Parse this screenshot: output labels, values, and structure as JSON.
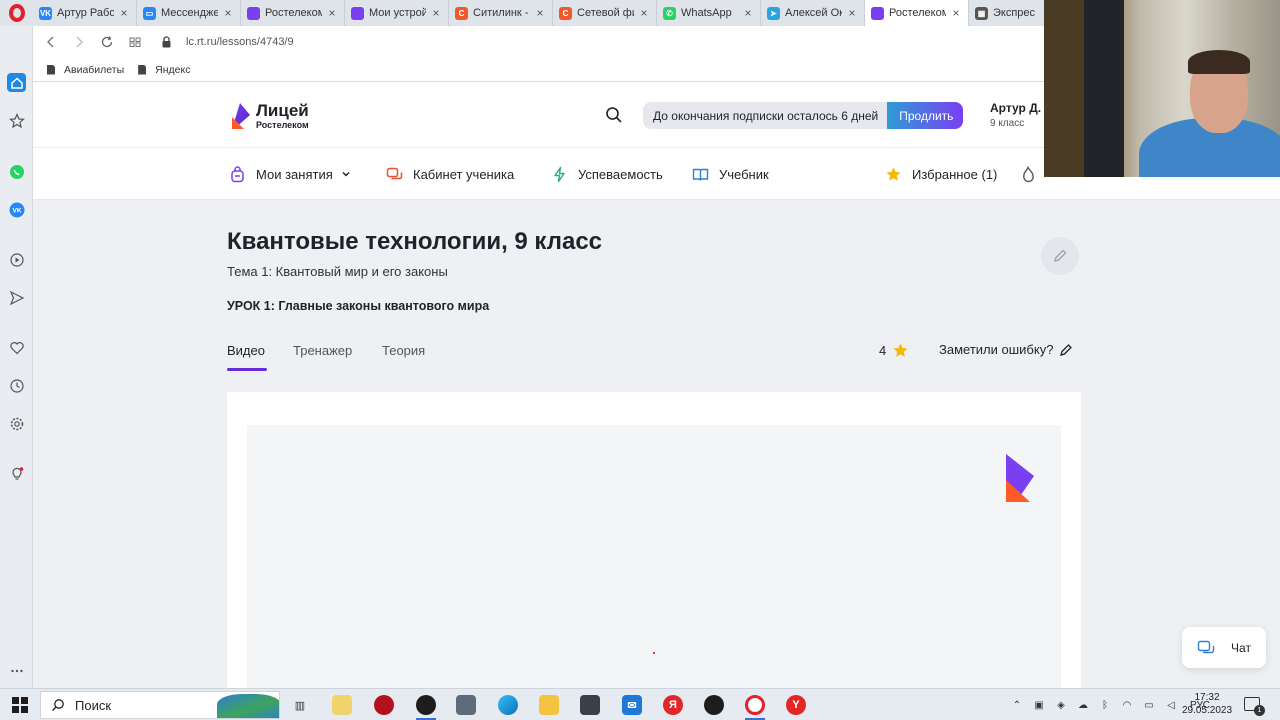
{
  "browser": {
    "tabs": [
      {
        "title": "Артур Работа",
        "favicon": "vk-icon",
        "color": "#2787f5",
        "glyph": "VK",
        "active": false
      },
      {
        "title": "Мессенджер",
        "favicon": "messenger-icon",
        "color": "#2787f5",
        "glyph": "▭",
        "active": false
      },
      {
        "title": "Ростелеком",
        "favicon": "rostelecom-icon",
        "color": "#7b3ff2",
        "glyph": "",
        "active": false
      },
      {
        "title": "Мои устройс",
        "favicon": "rostelecom-icon",
        "color": "#7b3ff2",
        "glyph": "",
        "active": false
      },
      {
        "title": "Ситилинк - и",
        "favicon": "citilink-icon",
        "color": "#f05a28",
        "glyph": "C",
        "active": false
      },
      {
        "title": "Сетевой фил",
        "favicon": "citilink-icon",
        "color": "#f05a28",
        "glyph": "C",
        "active": false
      },
      {
        "title": "WhatsApp",
        "favicon": "whatsapp-icon",
        "color": "#25d366",
        "glyph": "✆",
        "active": false
      },
      {
        "title": "Алексей Оку",
        "favicon": "telegram-icon",
        "color": "#2aa3de",
        "glyph": "➤",
        "active": false
      },
      {
        "title": "Ростелеком Л",
        "favicon": "rostelecom-icon",
        "color": "#7b3ff2",
        "glyph": "",
        "active": true
      },
      {
        "title": "Экспрес",
        "favicon": "speed-dial-icon",
        "color": "#555",
        "glyph": "▦",
        "active": false
      }
    ],
    "url": "lc.rt.ru/lessons/4743/9",
    "bookmarks": [
      "Авиабилеты",
      "Яндекс"
    ]
  },
  "site": {
    "logo_main": "Лицей",
    "logo_sub": "Ростелеком",
    "subscription_notice": "До окончания подписки осталось 6 дней",
    "renew_label": "Продлить",
    "user_name": "Артур Д.",
    "user_grade": "9 класс",
    "nav": [
      "Мои занятия",
      "Кабинет ученика",
      "Успеваемость",
      "Учебник",
      "Избранное (1)"
    ]
  },
  "lesson": {
    "course_title": "Квантовые технологии, 9 класс",
    "topic": "Тема 1: Квантовый мир и его законы",
    "lesson_title": "УРОК 1: Главные законы квантового мира",
    "tabs": [
      "Видео",
      "Тренажер",
      "Теория"
    ],
    "active_tab": "Видео",
    "rating": "4",
    "report_label": "Заметили ошибку?",
    "chat_label": "Чат"
  },
  "taskbar": {
    "search_placeholder": "Поиск",
    "language": "РУС",
    "time": "17:32",
    "date": "29.05.2023",
    "notification_count": "1"
  },
  "colors": {
    "accent_purple": "#7b3ff2",
    "underline": "#6a2bd9",
    "renew_gradient_start": "#2f9cd4",
    "page_bg": "#eef0f4"
  }
}
